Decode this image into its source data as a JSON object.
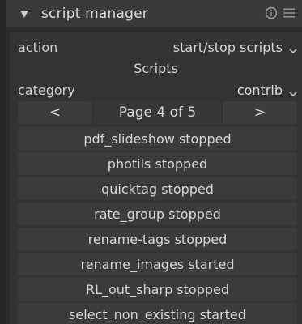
{
  "module": {
    "title": "script manager",
    "icons": [
      "collapse-triangle-icon",
      "info-icon",
      "hamburger-menu-icon"
    ]
  },
  "action": {
    "label": "action",
    "value": "start/stop scripts"
  },
  "section": {
    "title": "Scripts"
  },
  "category": {
    "label": "category",
    "value": "contrib"
  },
  "pager": {
    "prev": "<",
    "page_label": "Page 4 of 5",
    "next": ">"
  },
  "scripts": [
    "pdf_slideshow stopped",
    "photils stopped",
    "quicktag stopped",
    "rate_group stopped",
    "rename-tags stopped",
    "rename_images started",
    "RL_out_sharp stopped",
    "select_non_existing started"
  ]
}
